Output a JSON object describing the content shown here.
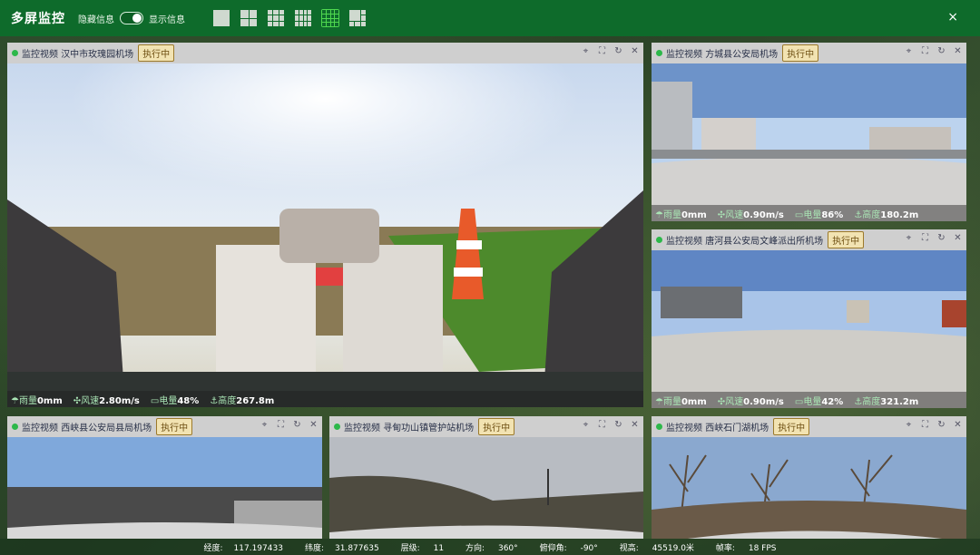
{
  "topbar": {
    "title": "多屏监控",
    "hide_info": "隐藏信息",
    "show_info": "显示信息",
    "layouts": [
      {
        "name": "layout-1-icon",
        "cells": 1
      },
      {
        "name": "layout-4-icon",
        "cells": 4
      },
      {
        "name": "layout-9-icon",
        "cells": 9
      },
      {
        "name": "layout-12-icon",
        "cells": 12
      },
      {
        "name": "layout-16-icon",
        "cells": 16,
        "active": true
      },
      {
        "name": "layout-6-icon",
        "cells": 6
      }
    ],
    "close": "×"
  },
  "panels": [
    {
      "label": "监控视频",
      "site": "汉中市玫瑰园机场",
      "status": "执行中",
      "rain": "0mm",
      "wind": "2.80m/s",
      "battery": "48%",
      "height": "267.8m"
    },
    {
      "label": "监控视频",
      "site": "方城县公安局机场",
      "status": "执行中",
      "rain": "0mm",
      "wind": "0.90m/s",
      "battery": "86%",
      "height": "180.2m"
    },
    {
      "label": "监控视频",
      "site": "唐河县公安局文峰派出所机场",
      "status": "执行中",
      "rain": "0mm",
      "wind": "0.90m/s",
      "battery": "42%",
      "height": "321.2m"
    },
    {
      "label": "监控视频",
      "site": "西峡县公安局县局机场",
      "status": "执行中"
    },
    {
      "label": "监控视频",
      "site": "寻甸功山镇管护站机场",
      "status": "执行中"
    },
    {
      "label": "监控视频",
      "site": "西峡石门湖机场",
      "status": "执行中"
    }
  ],
  "metric_labels": {
    "rain": "雨量",
    "wind": "风速",
    "battery": "电量",
    "height": "高度"
  },
  "bottom": {
    "lng_label": "经度:",
    "lng": "117.197433",
    "lat_label": "纬度:",
    "lat": "31.877635",
    "level_label": "层级:",
    "level": "11",
    "heading_label": "方向:",
    "heading": "360°",
    "pitch_label": "俯仰角:",
    "pitch": "-90°",
    "view_label": "视高:",
    "view": "45519.0米",
    "fps_label": "帧率:",
    "fps": "18 FPS"
  }
}
